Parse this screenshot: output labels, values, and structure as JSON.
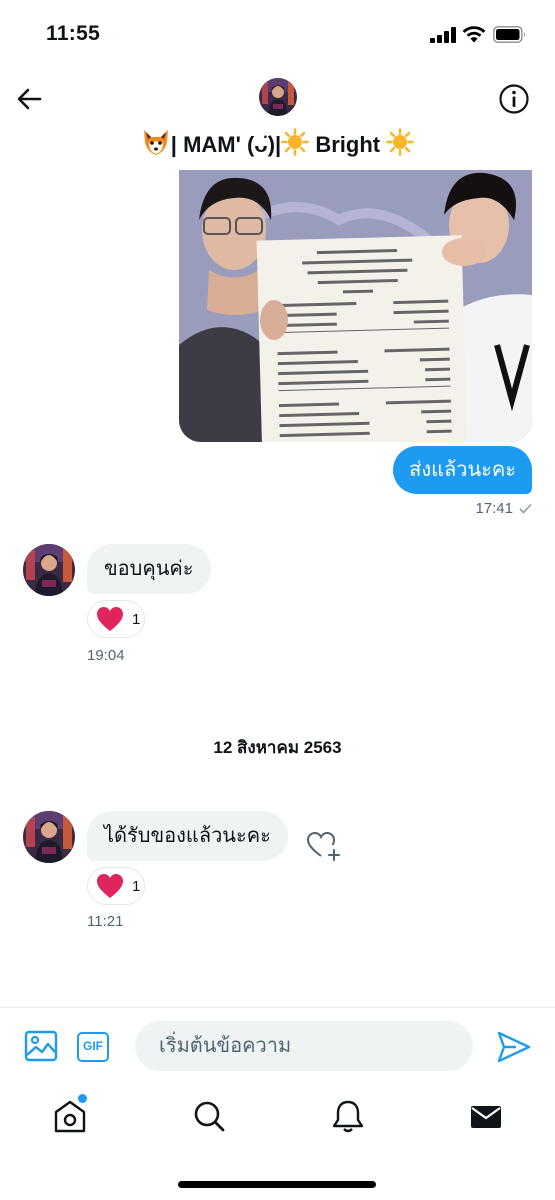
{
  "status_bar": {
    "time": "11:55"
  },
  "header": {
    "title_prefix": "| MAM' (ㆆᴗㆆ)",
    "title_middle": " Bright ",
    "title_display": "| MAM' ̈ٯ|",
    "icons": [
      "back-arrow-icon",
      "info-icon"
    ]
  },
  "messages": {
    "sent": {
      "text": "ส่งแล้วนะคะ",
      "time": "17:41"
    },
    "received_1": {
      "text": "ขอบคุนค่ะ",
      "reaction_count": "1",
      "time": "19:04"
    },
    "date_divider": "12 สิงหาคม 2563",
    "received_2": {
      "text": "ได้รับของแล้วนะคะ",
      "reaction_count": "1",
      "time": "11:21"
    }
  },
  "composer": {
    "placeholder": "เริ่มต้นข้อความ",
    "gif_label": "GIF"
  },
  "colors": {
    "accent": "#1d9bf0",
    "bubble_in": "#eff3f4",
    "heart": "#e0245e"
  },
  "nav": [
    "home-icon",
    "search-icon",
    "bell-icon",
    "mail-icon"
  ]
}
